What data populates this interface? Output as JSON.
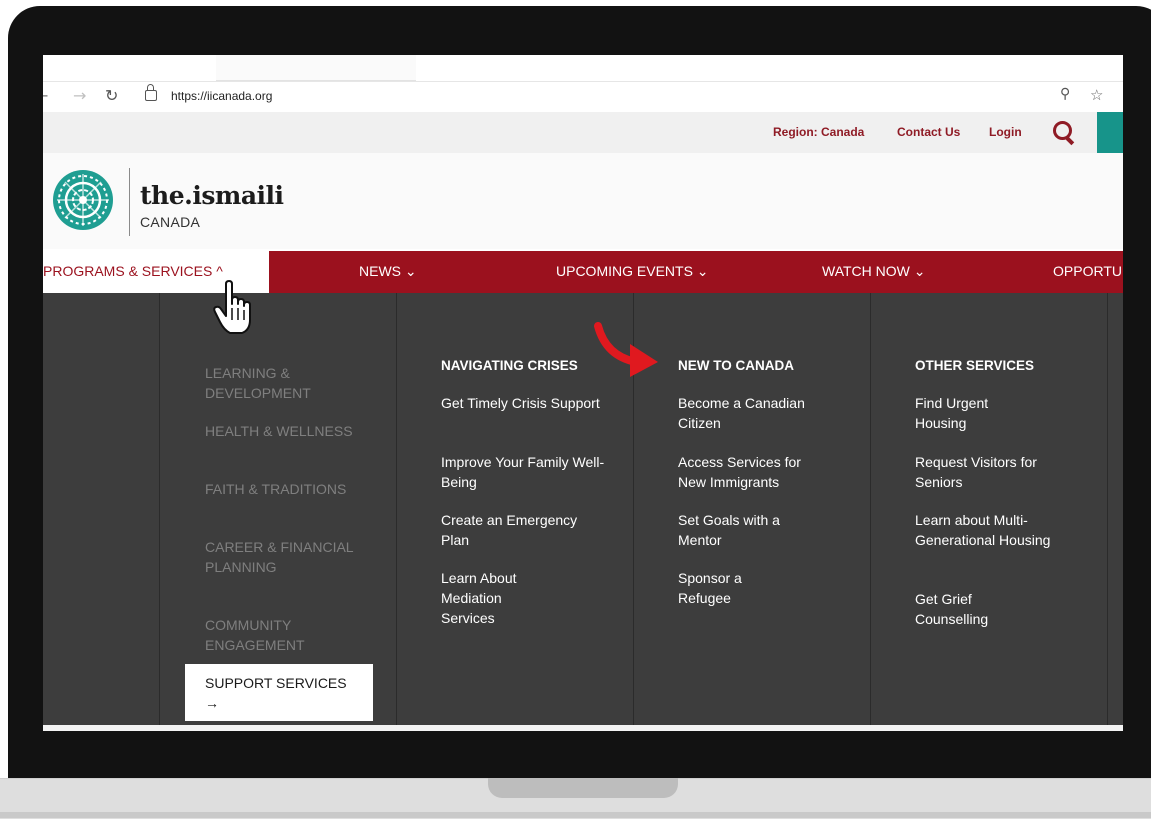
{
  "browser": {
    "url": "https://iicanada.org",
    "back_glyph": "←",
    "forward_glyph": "→",
    "reload_glyph": "↻",
    "key_glyph": "⚲",
    "star_glyph": "☆"
  },
  "utility_bar": {
    "region": "Region: Canada",
    "contact": "Contact Us",
    "login": "Login",
    "search_icon": "search-icon"
  },
  "logo": {
    "name": "the.ismaili",
    "sub": "CANADA"
  },
  "main_nav": [
    "PROGRAMS & SERVICES ^",
    "NEWS ⌄",
    "UPCOMING EVENTS ⌄",
    "WATCH NOW ⌄",
    "OPPORTU"
  ],
  "sub_menu": [
    "LEARNING & DEVELOPMENT",
    "HEALTH & WELLNESS",
    "FAITH & TRADITIONS",
    "CAREER & FINANCIAL PLANNING",
    "COMMUNITY ENGAGEMENT",
    "SUPPORT SERVICES →"
  ],
  "columns": [
    {
      "heading": "NAVIGATING CRISES",
      "links": [
        "Get Timely Crisis Support",
        "Improve Your Family Well-Being",
        "Create an Emergency Plan",
        "Learn About Mediation Services"
      ]
    },
    {
      "heading": "NEW TO CANADA",
      "links": [
        "Become a Canadian Citizen",
        "Access Services for New Immigrants",
        "Set Goals with a Mentor",
        "Sponsor a Refugee"
      ]
    },
    {
      "heading": "OTHER SERVICES",
      "links": [
        "Find Urgent Housing",
        "Request Visitors for Seniors",
        "Learn about Multi-Generational Housing",
        "Get Grief Counselling"
      ]
    }
  ],
  "colors": {
    "brand_red": "#9b111e",
    "teal": "#17948a",
    "menu_bg": "#3d3d3d"
  }
}
